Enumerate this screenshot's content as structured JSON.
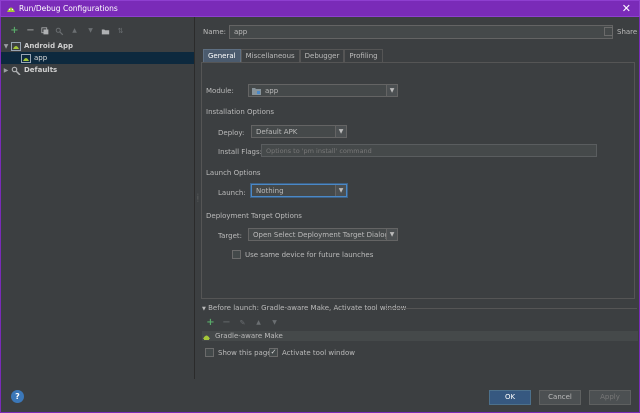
{
  "window": {
    "title": "Run/Debug Configurations",
    "close_glyph": "✕"
  },
  "left": {
    "toolbar": [
      {
        "glyph": "+",
        "name": "add-icon"
      },
      {
        "glyph": "−",
        "name": "remove-icon"
      },
      {
        "glyph": "⧉",
        "name": "copy-icon"
      },
      {
        "glyph": "🔧",
        "name": "wrench-icon"
      },
      {
        "glyph": "▲",
        "name": "move-up-icon"
      },
      {
        "glyph": "▼",
        "name": "move-down-icon"
      },
      {
        "glyph": "▮",
        "name": "folder-icon"
      },
      {
        "glyph": "⇅",
        "name": "sort-icon"
      }
    ],
    "tree": {
      "android_app": "Android App",
      "app": "app",
      "defaults": "Defaults"
    }
  },
  "form": {
    "name_label": "Name:",
    "name_value": "app",
    "share_label": "Share",
    "tabs": [
      "General",
      "Miscellaneous",
      "Debugger",
      "Profiling"
    ],
    "module_label": "Module:",
    "module_value": "app",
    "installation_options": "Installation Options",
    "deploy_label": "Deploy:",
    "deploy_value": "Default APK",
    "install_flags_label": "Install Flags:",
    "install_flags_placeholder": "Options to 'pm install' command",
    "launch_options": "Launch Options",
    "launch_label": "Launch:",
    "launch_value": "Nothing",
    "deployment_target_options": "Deployment Target Options",
    "target_label": "Target:",
    "target_value": "Open Select Deployment Target Dialog",
    "same_device_label": "Use same device for future launches"
  },
  "before_launch": {
    "header": "Before launch: Gradle-aware Make, Activate tool window",
    "items": [
      "Gradle-aware Make"
    ],
    "show_page_label": "Show this page",
    "activate_tool_window_label": "Activate tool window"
  },
  "buttons": {
    "help": "?",
    "ok": "OK",
    "cancel": "Cancel",
    "apply": "Apply"
  },
  "colors": {
    "titlebar": "#7a2bb8",
    "accent": "#4a88c7",
    "android_green": "#a4c639"
  }
}
